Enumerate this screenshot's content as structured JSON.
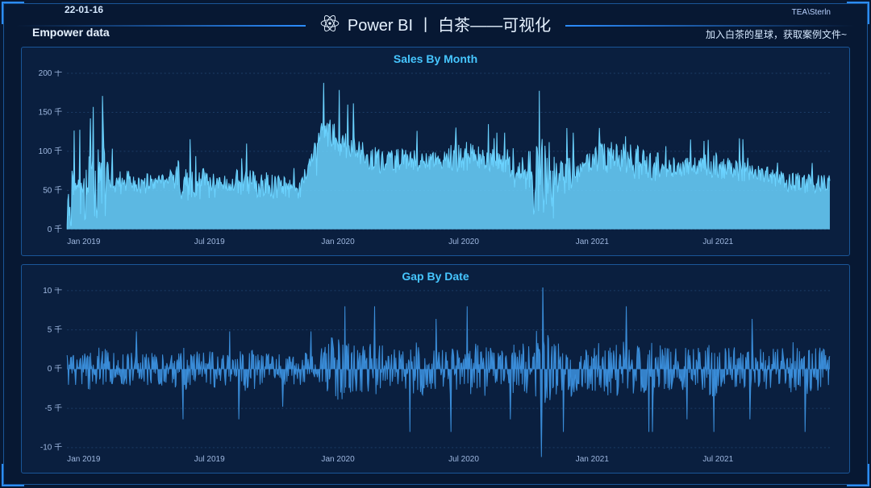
{
  "header": {
    "date": "22-01-16",
    "title": "Power BI 丨 白茶——可视化",
    "user": "TEA\\Sterln",
    "subtitle_left": "Empower data",
    "subtitle_right": "加入白茶的星球，获取案例文件~"
  },
  "panels": {
    "sales": {
      "title": "Sales By Month"
    },
    "gap": {
      "title": "Gap By Date"
    }
  },
  "chart_data": [
    {
      "type": "area",
      "title": "Sales By Month",
      "xlabel": "",
      "ylabel": "",
      "y_unit": "千",
      "ylim": [
        0,
        200
      ],
      "y_ticks": [
        0,
        50,
        100,
        150,
        200
      ],
      "x_ticks": [
        "Jan 2019",
        "Jul 2019",
        "Jan 2020",
        "Jul 2020",
        "Jan 2021",
        "Jul 2021"
      ],
      "x_range_months": 36,
      "series": [
        {
          "name": "Sales",
          "approx_monthly_mean": [
            30,
            55,
            60,
            60,
            58,
            65,
            60,
            55,
            62,
            58,
            55,
            50,
            130,
            110,
            95,
            85,
            90,
            85,
            90,
            95,
            88,
            78,
            72,
            68,
            70,
            95,
            90,
            85,
            78,
            80,
            82,
            78,
            75,
            70,
            60,
            58
          ],
          "approx_monthly_peak": [
            120,
            160,
            95,
            90,
            85,
            120,
            105,
            80,
            100,
            95,
            85,
            75,
            175,
            150,
            130,
            120,
            120,
            115,
            135,
            130,
            120,
            140,
            200,
            120,
            100,
            145,
            140,
            130,
            105,
            105,
            115,
            110,
            100,
            95,
            90,
            85
          ],
          "note": "daily data; values above are monthly mean/peak estimates (thousands)"
        }
      ]
    },
    {
      "type": "line",
      "title": "Gap By Date",
      "xlabel": "",
      "ylabel": "",
      "y_unit": "千",
      "ylim": [
        -10,
        10
      ],
      "y_ticks": [
        -10,
        -5,
        0,
        5,
        10
      ],
      "x_ticks": [
        "Jan 2019",
        "Jul 2019",
        "Jan 2020",
        "Jul 2020",
        "Jan 2021",
        "Jul 2021"
      ],
      "x_range_months": 36,
      "series": [
        {
          "name": "Gap",
          "approx_monthly_amplitude": [
            3,
            4,
            3,
            3,
            3,
            4,
            4,
            3,
            4,
            3,
            3,
            3,
            6,
            5,
            5,
            4,
            5,
            4,
            5,
            5,
            4,
            5,
            7,
            5,
            4,
            5,
            5,
            5,
            4,
            4,
            5,
            4,
            4,
            4,
            5,
            4
          ],
          "mean": 0,
          "note": "daily data oscillating around 0; amplitude per month estimated (thousands)"
        }
      ]
    }
  ]
}
